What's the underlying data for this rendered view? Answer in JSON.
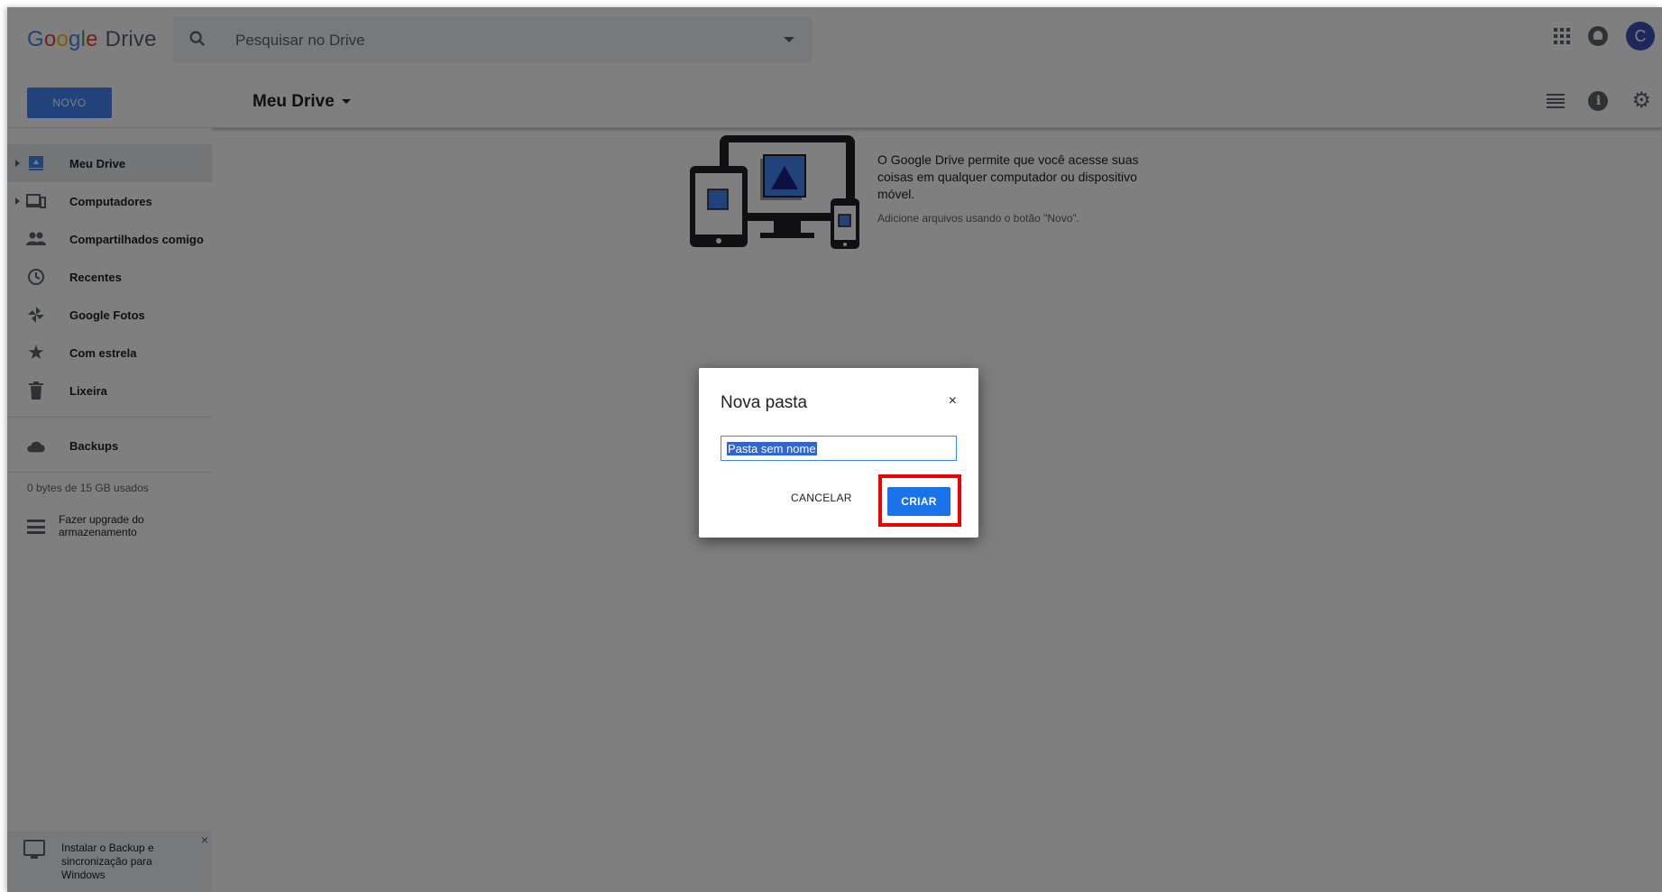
{
  "header": {
    "logo": {
      "letters": [
        "G",
        "o",
        "o",
        "g",
        "l",
        "e"
      ],
      "product": "Drive"
    },
    "search_placeholder": "Pesquisar no Drive",
    "avatar_initial": "C"
  },
  "toolbar": {
    "new_button": "NOVO",
    "breadcrumb": "Meu Drive"
  },
  "sidebar": {
    "items": [
      {
        "label": "Meu Drive",
        "icon": "drive-folder-icon"
      },
      {
        "label": "Computadores",
        "icon": "computers-icon"
      },
      {
        "label": "Compartilhados comigo",
        "icon": "shared-people-icon"
      },
      {
        "label": "Recentes",
        "icon": "clock-icon"
      },
      {
        "label": "Google Fotos",
        "icon": "pinwheel-icon"
      },
      {
        "label": "Com estrela",
        "icon": "star-icon"
      },
      {
        "label": "Lixeira",
        "icon": "trash-icon"
      }
    ],
    "backups": {
      "label": "Backups",
      "icon": "cloud-icon"
    },
    "storage_text": "0 bytes de 15 GB usados",
    "upgrade_label": "Fazer upgrade do armazenamento",
    "install_banner": "Instalar o Backup e sincronização para Windows",
    "install_close": "×"
  },
  "empty_state": {
    "message": "O Google Drive permite que você acesse suas coisas em qualquer computador ou dispositivo móvel.",
    "hint": "Adicione arquivos usando o botão \"Novo\"."
  },
  "dialog": {
    "title": "Nova pasta",
    "close": "×",
    "input_value": "Pasta sem nome",
    "cancel_label": "CANCELAR",
    "create_label": "CRIAR"
  },
  "colors": {
    "accent": "#4285f4",
    "primary_button": "#1a73e8",
    "highlight_box": "#ee0000",
    "overlay": "rgba(0,0,0,0.5)"
  }
}
